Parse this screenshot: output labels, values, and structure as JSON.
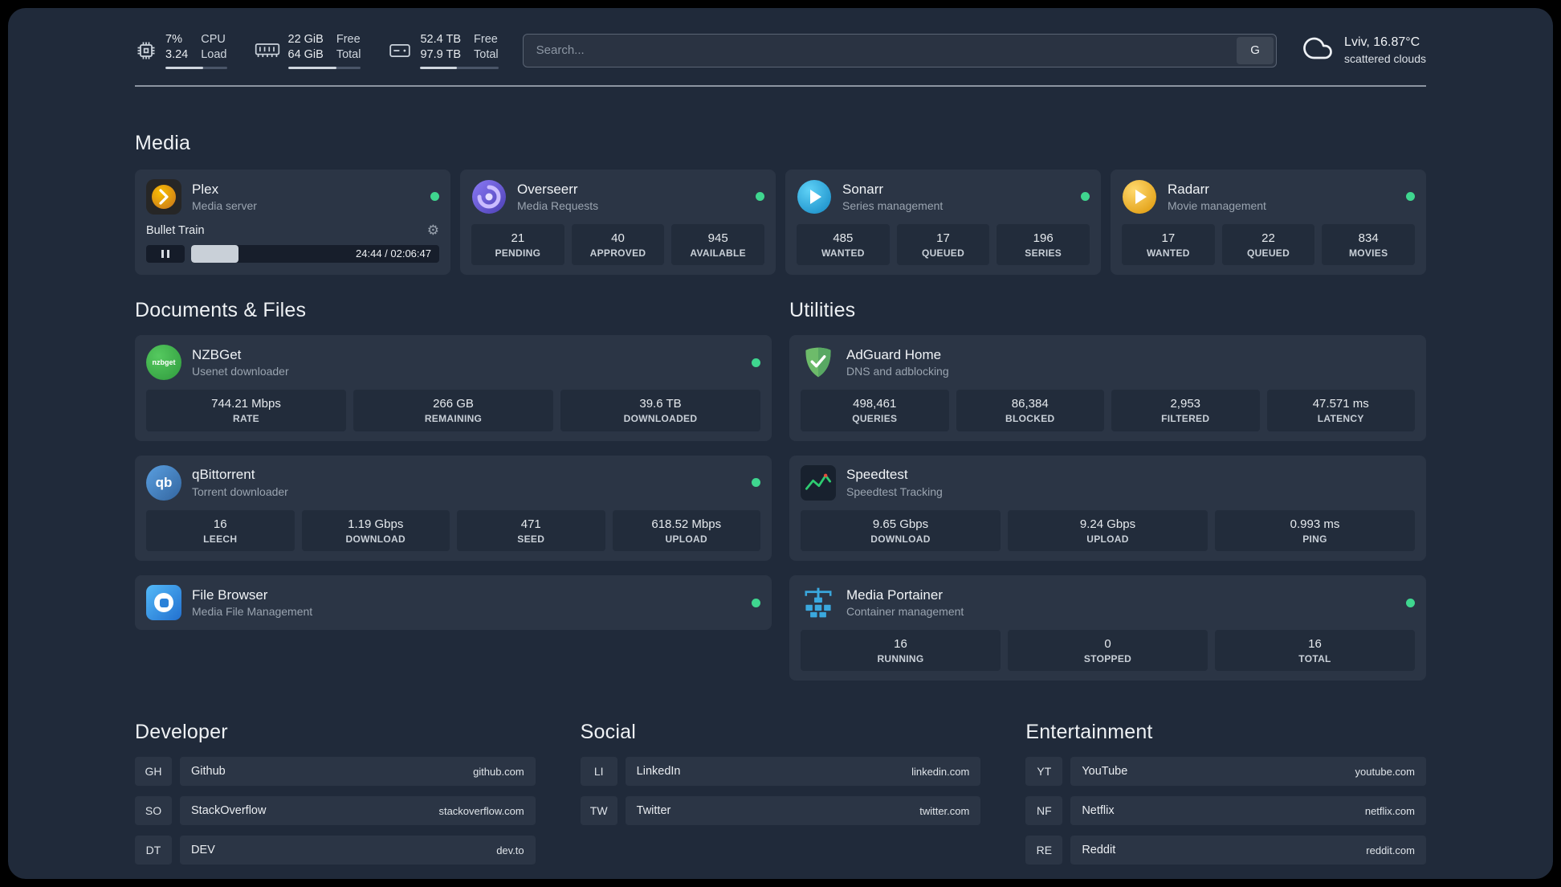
{
  "colors": {
    "background": "#202a3a",
    "card": "#2b3545",
    "stat_block": "#222c3b",
    "status_online": "#3fd68f",
    "plex_brand": "#ebaf00",
    "overseerr_brand": "#7c6bee",
    "sonarr_brand": "#35c5f4",
    "radarr_brand": "#f4c33b",
    "nzbget_brand": "#3db14c",
    "qbittorrent_brand": "#4a84c9",
    "filebrowser_brand": "#2f8fe8",
    "adguard_brand": "#68bc71",
    "speedtest_accent": "#2ecc71",
    "portainer_brand": "#3aa8de"
  },
  "icons": {
    "cpu": "cpu-chip-outline",
    "memory": "ram-stick-outline",
    "disk": "hard-drive-outline",
    "weather": "cloud-outline",
    "settings": "gear ⚙",
    "pause": "pause-bars",
    "status": "green-dot"
  },
  "topbar": {
    "metrics": [
      {
        "name": "cpu",
        "top_left": "7%",
        "bottom_left": "3.24",
        "top_right": "CPU",
        "bottom_right": "Load",
        "bar_percent": 62
      },
      {
        "name": "memory",
        "top_left": "22 GiB",
        "bottom_left": "64 GiB",
        "top_right": "Free",
        "bottom_right": "Total",
        "bar_percent": 66
      },
      {
        "name": "disk",
        "top_left": "52.4 TB",
        "bottom_left": "97.9 TB",
        "top_right": "Free",
        "bottom_right": "Total",
        "bar_percent": 47
      }
    ],
    "search": {
      "placeholder": "Search...",
      "provider_button": "G"
    },
    "weather": {
      "location": "Lviv, 16.87°C",
      "condition": "scattered clouds"
    }
  },
  "sections": {
    "media": {
      "title": "Media",
      "cards": [
        {
          "name": "Plex",
          "subtitle": "Media server",
          "online": true,
          "now_playing": "Bullet Train",
          "time": "24:44 / 02:06:47",
          "progress_percent": 19
        },
        {
          "name": "Overseerr",
          "subtitle": "Media Requests",
          "online": true,
          "stats": [
            {
              "value": "21",
              "label": "PENDING"
            },
            {
              "value": "40",
              "label": "APPROVED"
            },
            {
              "value": "945",
              "label": "AVAILABLE"
            }
          ]
        },
        {
          "name": "Sonarr",
          "subtitle": "Series management",
          "online": true,
          "stats": [
            {
              "value": "485",
              "label": "WANTED"
            },
            {
              "value": "17",
              "label": "QUEUED"
            },
            {
              "value": "196",
              "label": "SERIES"
            }
          ]
        },
        {
          "name": "Radarr",
          "subtitle": "Movie management",
          "online": true,
          "stats": [
            {
              "value": "17",
              "label": "WANTED"
            },
            {
              "value": "22",
              "label": "QUEUED"
            },
            {
              "value": "834",
              "label": "MOVIES"
            }
          ]
        }
      ]
    },
    "documents": {
      "title": "Documents & Files",
      "cards": [
        {
          "name": "NZBGet",
          "subtitle": "Usenet downloader",
          "online": true,
          "stats": [
            {
              "value": "744.21 Mbps",
              "label": "RATE"
            },
            {
              "value": "266 GB",
              "label": "REMAINING"
            },
            {
              "value": "39.6 TB",
              "label": "DOWNLOADED"
            }
          ]
        },
        {
          "name": "qBittorrent",
          "subtitle": "Torrent downloader",
          "online": true,
          "stats": [
            {
              "value": "16",
              "label": "LEECH"
            },
            {
              "value": "1.19 Gbps",
              "label": "DOWNLOAD"
            },
            {
              "value": "471",
              "label": "SEED"
            },
            {
              "value": "618.52 Mbps",
              "label": "UPLOAD"
            }
          ]
        },
        {
          "name": "File Browser",
          "subtitle": "Media File Management",
          "online": true
        }
      ]
    },
    "utilities": {
      "title": "Utilities",
      "cards": [
        {
          "name": "AdGuard Home",
          "subtitle": "DNS and adblocking",
          "stats": [
            {
              "value": "498,461",
              "label": "QUERIES"
            },
            {
              "value": "86,384",
              "label": "BLOCKED"
            },
            {
              "value": "2,953",
              "label": "FILTERED"
            },
            {
              "value": "47.571 ms",
              "label": "LATENCY"
            }
          ]
        },
        {
          "name": "Speedtest",
          "subtitle": "Speedtest Tracking",
          "stats": [
            {
              "value": "9.65 Gbps",
              "label": "DOWNLOAD"
            },
            {
              "value": "9.24 Gbps",
              "label": "UPLOAD"
            },
            {
              "value": "0.993 ms",
              "label": "PING"
            }
          ]
        },
        {
          "name": "Media Portainer",
          "subtitle": "Container management",
          "online": true,
          "stats": [
            {
              "value": "16",
              "label": "RUNNING"
            },
            {
              "value": "0",
              "label": "STOPPED"
            },
            {
              "value": "16",
              "label": "TOTAL"
            }
          ]
        }
      ]
    }
  },
  "bookmarks": [
    {
      "title": "Developer",
      "items": [
        {
          "abbr": "GH",
          "name": "Github",
          "url": "github.com"
        },
        {
          "abbr": "SO",
          "name": "StackOverflow",
          "url": "stackoverflow.com"
        },
        {
          "abbr": "DT",
          "name": "DEV",
          "url": "dev.to"
        }
      ]
    },
    {
      "title": "Social",
      "items": [
        {
          "abbr": "LI",
          "name": "LinkedIn",
          "url": "linkedin.com"
        },
        {
          "abbr": "TW",
          "name": "Twitter",
          "url": "twitter.com"
        }
      ]
    },
    {
      "title": "Entertainment",
      "items": [
        {
          "abbr": "YT",
          "name": "YouTube",
          "url": "youtube.com"
        },
        {
          "abbr": "NF",
          "name": "Netflix",
          "url": "netflix.com"
        },
        {
          "abbr": "RE",
          "name": "Reddit",
          "url": "reddit.com"
        }
      ]
    }
  ]
}
